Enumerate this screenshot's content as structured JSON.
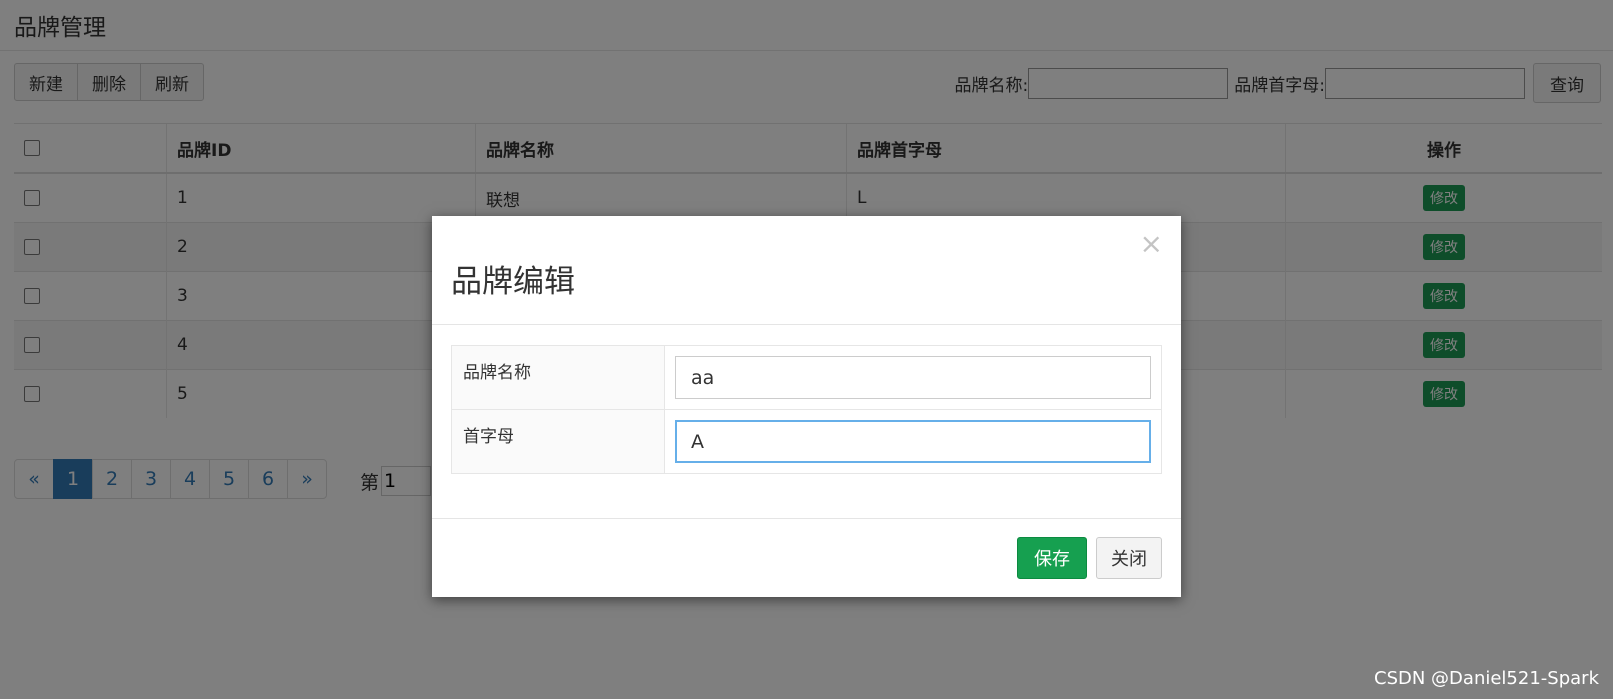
{
  "page": {
    "title": "品牌管理"
  },
  "toolbar": {
    "new_label": "新建",
    "delete_label": "删除",
    "refresh_label": "刷新"
  },
  "search": {
    "name_label": "品牌名称:",
    "initial_label": "品牌首字母:",
    "query_label": "查询",
    "name_value": "",
    "initial_value": ""
  },
  "table": {
    "headers": {
      "id": "品牌ID",
      "name": "品牌名称",
      "initial": "品牌首字母",
      "action": "操作"
    },
    "rows": [
      {
        "id": "1",
        "name": "联想",
        "initial": "L",
        "action": "修改"
      },
      {
        "id": "2",
        "name": "",
        "initial": "",
        "action": "修改"
      },
      {
        "id": "3",
        "name": "",
        "initial": "",
        "action": "修改"
      },
      {
        "id": "4",
        "name": "",
        "initial": "",
        "action": "修改"
      },
      {
        "id": "5",
        "name": "",
        "initial": "",
        "action": "修改"
      }
    ]
  },
  "pager": {
    "prev": "«",
    "next": "»",
    "pages": [
      "1",
      "2",
      "3",
      "4",
      "5",
      "6"
    ],
    "active_page": "1",
    "goto_label": "第",
    "goto_value": "1"
  },
  "modal": {
    "title": "品牌编辑",
    "close_glyph": "×",
    "fields": {
      "name_label": "品牌名称",
      "name_value": "aa",
      "initial_label": "首字母",
      "initial_value": "A"
    },
    "save_label": "保存",
    "close_label": "关闭"
  },
  "watermark": "CSDN @Daniel521-Spark",
  "colors": {
    "primary": "#337ab7",
    "success": "#16a050"
  }
}
